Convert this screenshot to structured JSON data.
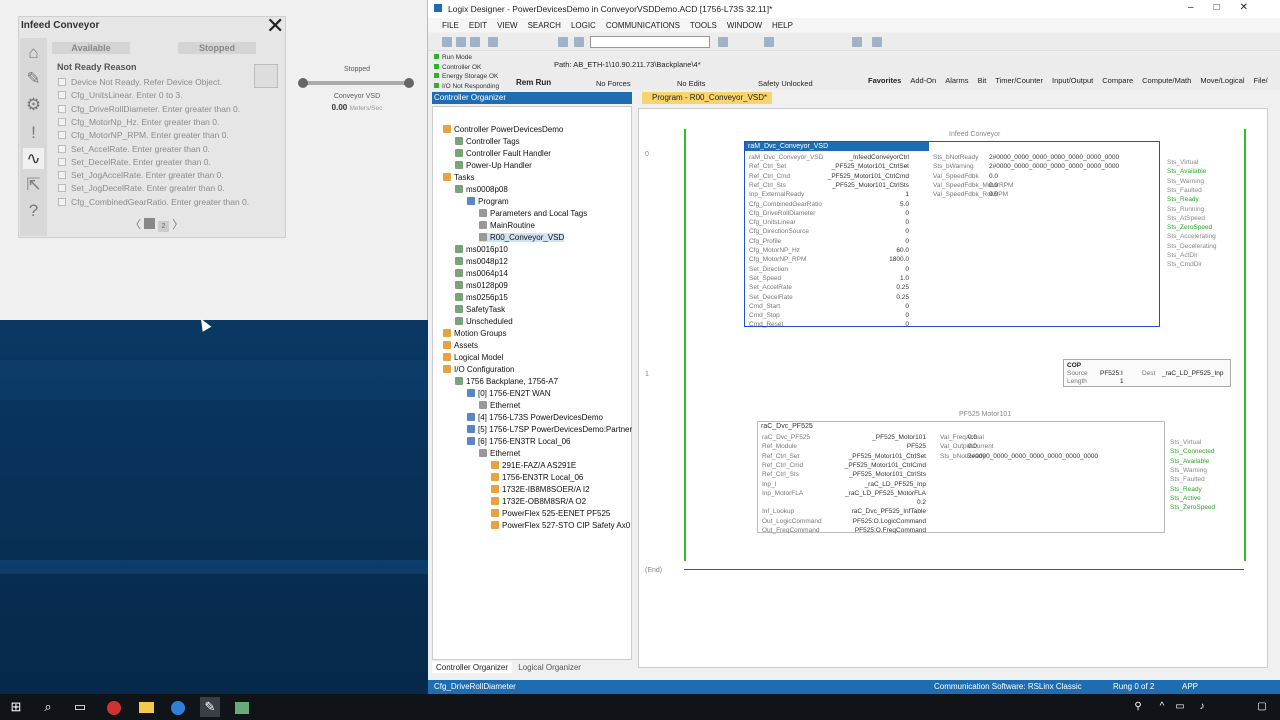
{
  "faceplate": {
    "title": "Infeed Conveyor",
    "close": "✕",
    "tabs": {
      "available": "Available",
      "stopped": "Stopped"
    },
    "not_ready_heading": "Not Ready Reason",
    "reasons": [
      "Device Not Ready. Refer Device Object.",
      "Cfg_UnitsLinear. Enter 0 to 3.",
      "Cfg_DriveRollDiameter. Enter greater than 0.",
      "Cfg_MotorNp_Hz. Enter greater than 0.",
      "Cfg_MotorNP_RPM. Enter greater than 0.",
      "Set_AccelRate. Enter greater than 0.",
      "Set_DecelRate. Enter greater than 0.",
      "Set_JogAccelRate. Enter greater than 0.",
      "Set_JogDecelRate. Enter greater than 0.",
      "Cfg_CombinedGearRatio. Enter greater than 0."
    ],
    "pager": {
      "prev": "〈",
      "page": "2",
      "next": "〉"
    },
    "indicator": {
      "state": "Stopped",
      "name": "Conveyor VSD",
      "value": "0.00",
      "unit": "Meters/Sec"
    }
  },
  "logix": {
    "title": "Logix Designer - PowerDevicesDemo in ConveyorVSDDemo.ACD [1756-L73S 32.11]*",
    "menu": [
      "FILE",
      "EDIT",
      "VIEW",
      "SEARCH",
      "LOGIC",
      "COMMUNICATIONS",
      "TOOLS",
      "WINDOW",
      "HELP"
    ],
    "status": [
      "Run Mode",
      "Controller OK",
      "Energy Storage OK",
      "I/O Not Responding"
    ],
    "path_label": "Path:",
    "path": "AB_ETH-1\\10.90.211.73\\Backplane\\4*",
    "rem_run": "Rem Run",
    "no_forces": "No Forces",
    "no_edits": "No Edits",
    "safety": "Safety Unlocked",
    "fav_tabs": [
      "Favorites",
      "Add-On",
      "Alarms",
      "Bit",
      "Timer/Counter",
      "Input/Output",
      "Compare",
      "Compute/Math",
      "Move/Logical",
      "File/"
    ],
    "organizer_title": "Controller Organizer",
    "tree": [
      {
        "label": "Controller PowerDevicesDemo",
        "indent": 0
      },
      {
        "label": "Controller Tags",
        "indent": 1
      },
      {
        "label": "Controller Fault Handler",
        "indent": 1
      },
      {
        "label": "Power-Up Handler",
        "indent": 1
      },
      {
        "label": "Tasks",
        "indent": 0
      },
      {
        "label": "ms0008p08",
        "indent": 1
      },
      {
        "label": "Program",
        "indent": 2
      },
      {
        "label": "Parameters and Local Tags",
        "indent": 3
      },
      {
        "label": "MainRoutine",
        "indent": 3
      },
      {
        "label": "R00_Conveyor_VSD",
        "indent": 3
      },
      {
        "label": "ms0016p10",
        "indent": 1
      },
      {
        "label": "ms0048p12",
        "indent": 1
      },
      {
        "label": "ms0064p14",
        "indent": 1
      },
      {
        "label": "ms0128p09",
        "indent": 1
      },
      {
        "label": "ms0256p15",
        "indent": 1
      },
      {
        "label": "SafetyTask",
        "indent": 1
      },
      {
        "label": "Unscheduled",
        "indent": 1
      },
      {
        "label": "Motion Groups",
        "indent": 0
      },
      {
        "label": "Assets",
        "indent": 0
      },
      {
        "label": "Logical Model",
        "indent": 0
      },
      {
        "label": "I/O Configuration",
        "indent": 0
      },
      {
        "label": "1756 Backplane, 1756-A7",
        "indent": 1
      },
      {
        "label": "[0] 1756-EN2T WAN",
        "indent": 2
      },
      {
        "label": "Ethernet",
        "indent": 3
      },
      {
        "label": "[4] 1756-L73S PowerDevicesDemo",
        "indent": 2
      },
      {
        "label": "[5] 1756-L7SP PowerDevicesDemo:Partner",
        "indent": 2
      },
      {
        "label": "[6] 1756-EN3TR Local_06",
        "indent": 2
      },
      {
        "label": "Ethernet",
        "indent": 3
      },
      {
        "label": "291E-FAZ/A AS291E",
        "indent": 4
      },
      {
        "label": "1756-EN3TR Local_06",
        "indent": 4
      },
      {
        "label": "1732E-IB8M8SOER/A I2",
        "indent": 4
      },
      {
        "label": "1732E-OB8M8SR/A O2",
        "indent": 4
      },
      {
        "label": "PowerFlex 525-EENET PF525",
        "indent": 4
      },
      {
        "label": "PowerFlex 527-STO CIP Safety Ax0",
        "indent": 4
      }
    ],
    "org_tabs": [
      "Controller Organizer",
      "Logical Organizer"
    ],
    "program_tab": "Program - R00_Conveyor_VSD*",
    "rung0_comment": "Infeed Conveyor",
    "fb1": {
      "title": "raM_Dvc_Conveyor_VSD",
      "inputs": [
        [
          "raM_Dvc_Conveyor_VSD",
          "_InfeedConveyorCtrl"
        ],
        [
          "Ref_Ctrl_Set",
          "_PF525_Motor101_CtrlSet"
        ],
        [
          "Ref_Ctrl_Cmd",
          "_PF525_Motor101_CtrlCmd"
        ],
        [
          "Ref_Ctrl_Sts",
          "_PF525_Motor101_CtrlSts"
        ],
        [
          "Inp_ExternalReady",
          "1"
        ],
        [
          "Cfg_CombinedGearRatio",
          "5.0"
        ],
        [
          "Cfg_DriveRollDiameter",
          "0"
        ],
        [
          "Cfg_UnitsLinear",
          "0"
        ],
        [
          "Cfg_DirectionSource",
          "0"
        ],
        [
          "Cfg_Profile",
          "0"
        ],
        [
          "Cfg_MotorNP_Hz",
          "60.0"
        ],
        [
          "Cfg_MotorNP_RPM",
          "1800.0"
        ],
        [
          "Set_Direction",
          "0"
        ],
        [
          "Set_Speed",
          "1.0"
        ],
        [
          "Set_AccelRate",
          "0.25"
        ],
        [
          "Set_DecelRate",
          "0.25"
        ],
        [
          "Cmd_Start",
          "0"
        ],
        [
          "Cmd_Stop",
          "0"
        ],
        [
          "Cmd_Reset",
          "0"
        ]
      ],
      "outputs": [
        [
          "Sts_bNotReady",
          "2#0000_0000_0000_0000_0000_0000_0000"
        ],
        [
          "Sts_bWarning",
          "2#0000_0000_0000_0000_0000_0000_0000"
        ],
        [
          "Val_SpeedFdbk",
          "0.0"
        ],
        [
          "Val_SpeedFdbk_MotorRPM",
          "0.0"
        ],
        [
          "Val_SpeedFdbk_RollRPM",
          "0.0"
        ]
      ],
      "signals": [
        [
          "Sts_Virtual",
          false
        ],
        [
          "Sts_Available",
          true
        ],
        [
          "Sts_Warning",
          false
        ],
        [
          "Sts_Faulted",
          false
        ],
        [
          "Sts_Ready",
          true
        ],
        [
          "Sts_Running",
          false
        ],
        [
          "Sts_AtSpeed",
          false
        ],
        [
          "Sts_ZeroSpeed",
          true
        ],
        [
          "Sts_Accelerating",
          false
        ],
        [
          "Sts_Decelerating",
          false
        ],
        [
          "Sts_ActDir",
          false
        ],
        [
          "Sts_CmdDir",
          false
        ]
      ]
    },
    "cop": {
      "name": "COP",
      "source_label": "Source",
      "source": "PF525:I",
      "length_label": "Length",
      "length": "1",
      "dest_label": "Dest",
      "dest": "_raC_LD_PF525_Inp"
    },
    "rung1_comment": "PF525 Motor101",
    "fb2": {
      "title": "raC_Dvc_PF525",
      "inputs": [
        [
          "raC_Dvc_PF525",
          "_PF525_Motor101"
        ],
        [
          "Ref_Module",
          "PF525"
        ],
        [
          "Ref_Ctrl_Set",
          "_PF525_Motor101_CtrlSet"
        ],
        [
          "Ref_Ctrl_Cmd",
          "_PF525_Motor101_CtrlCmd"
        ],
        [
          "Ref_Ctrl_Sts",
          "_PF525_Motor101_CtrlSts"
        ],
        [
          "Inp_I",
          "_raC_LD_PF525_Inp"
        ],
        [
          "Inp_MotorFLA",
          "_raC_LD_PF525_MotorFLA"
        ],
        [
          "",
          "0.2"
        ],
        [
          "Inf_Lookup",
          "raC_Dvc_PF525_InfTable"
        ],
        [
          "Out_LogicCommand",
          "PF525:O.LogicCommand"
        ],
        [
          "Out_FreqCommand",
          "PF525:O.FreqCommand"
        ]
      ],
      "outputs": [
        [
          "Val_FreqActual",
          "0.0"
        ],
        [
          "Val_OutputCurrent",
          "0.0"
        ],
        [
          "Sts_bNotReady",
          "2#0000_0000_0000_0000_0000_0000_0000"
        ]
      ],
      "signals": [
        [
          "Sts_Virtual",
          false
        ],
        [
          "Sts_Connected",
          true
        ],
        [
          "Sts_Available",
          true
        ],
        [
          "Sts_Warning",
          false
        ],
        [
          "Sts_Faulted",
          false
        ],
        [
          "Sts_Ready",
          true
        ],
        [
          "Sts_Active",
          true
        ],
        [
          "Sts_ZeroSpeed",
          true
        ]
      ]
    },
    "rung_nums": [
      "0",
      "1",
      "(End)"
    ],
    "status_left": "Cfg_DriveRollDiameter",
    "status_comm": "Communication Software: RSLinx Classic",
    "status_rung": "Rung 0 of 2",
    "status_app": "APP"
  },
  "taskbar": {
    "start": "⊞",
    "search": "⌕",
    "taskview": "▭"
  },
  "colors": {
    "accent": "#1e6db3",
    "rail_green": "#27c427",
    "on_green": "#2fb12f",
    "tab_yellow": "#f7d56c"
  }
}
